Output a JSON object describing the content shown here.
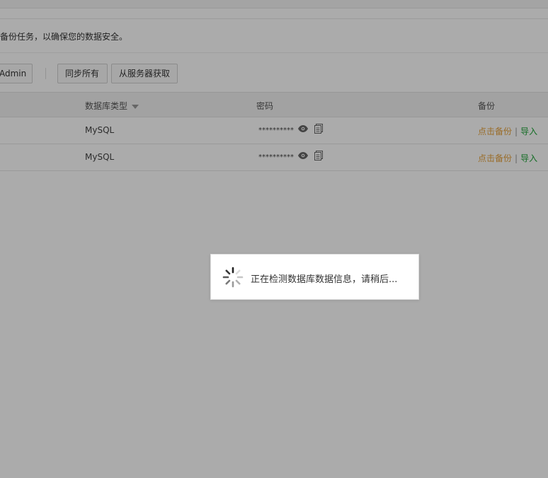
{
  "notice": {
    "text": "对备份任务，以确保您的数据安全。"
  },
  "toolbar": {
    "admin_label": "Admin",
    "sync_all_label": "同步所有",
    "fetch_from_server_label": "从服务器获取"
  },
  "table": {
    "headers": {
      "db_type": "数据库类型",
      "password": "密码",
      "backup": "备份"
    },
    "rows": [
      {
        "db_type": "MySQL",
        "password": "**********",
        "backup_link": "点击备份",
        "separator": "|",
        "import_link": "导入"
      },
      {
        "db_type": "MySQL",
        "password": "**********",
        "backup_link": "点击备份",
        "separator": "|",
        "import_link": "导入"
      }
    ]
  },
  "loading": {
    "message": "正在检测数据库数据信息，请稍后..."
  },
  "icons": {
    "show_password": "eye-icon",
    "copy": "clipboard-icon",
    "loading": "spinner-icon",
    "sort": "caret-down-icon"
  },
  "colors": {
    "backup_link": "#e6a23c",
    "import_link": "#20a53a",
    "overlay": "rgba(0,0,0,0.33)"
  }
}
